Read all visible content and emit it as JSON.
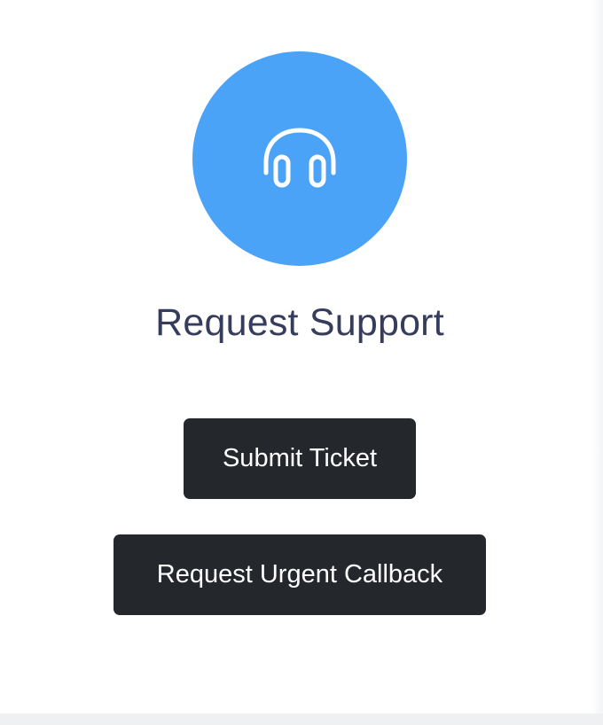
{
  "support": {
    "icon": "headset-icon",
    "accent_color": "#4ba3f8",
    "title": "Request Support",
    "buttons": {
      "submit_ticket_label": "Submit Ticket",
      "urgent_callback_label": "Request Urgent Callback"
    }
  }
}
